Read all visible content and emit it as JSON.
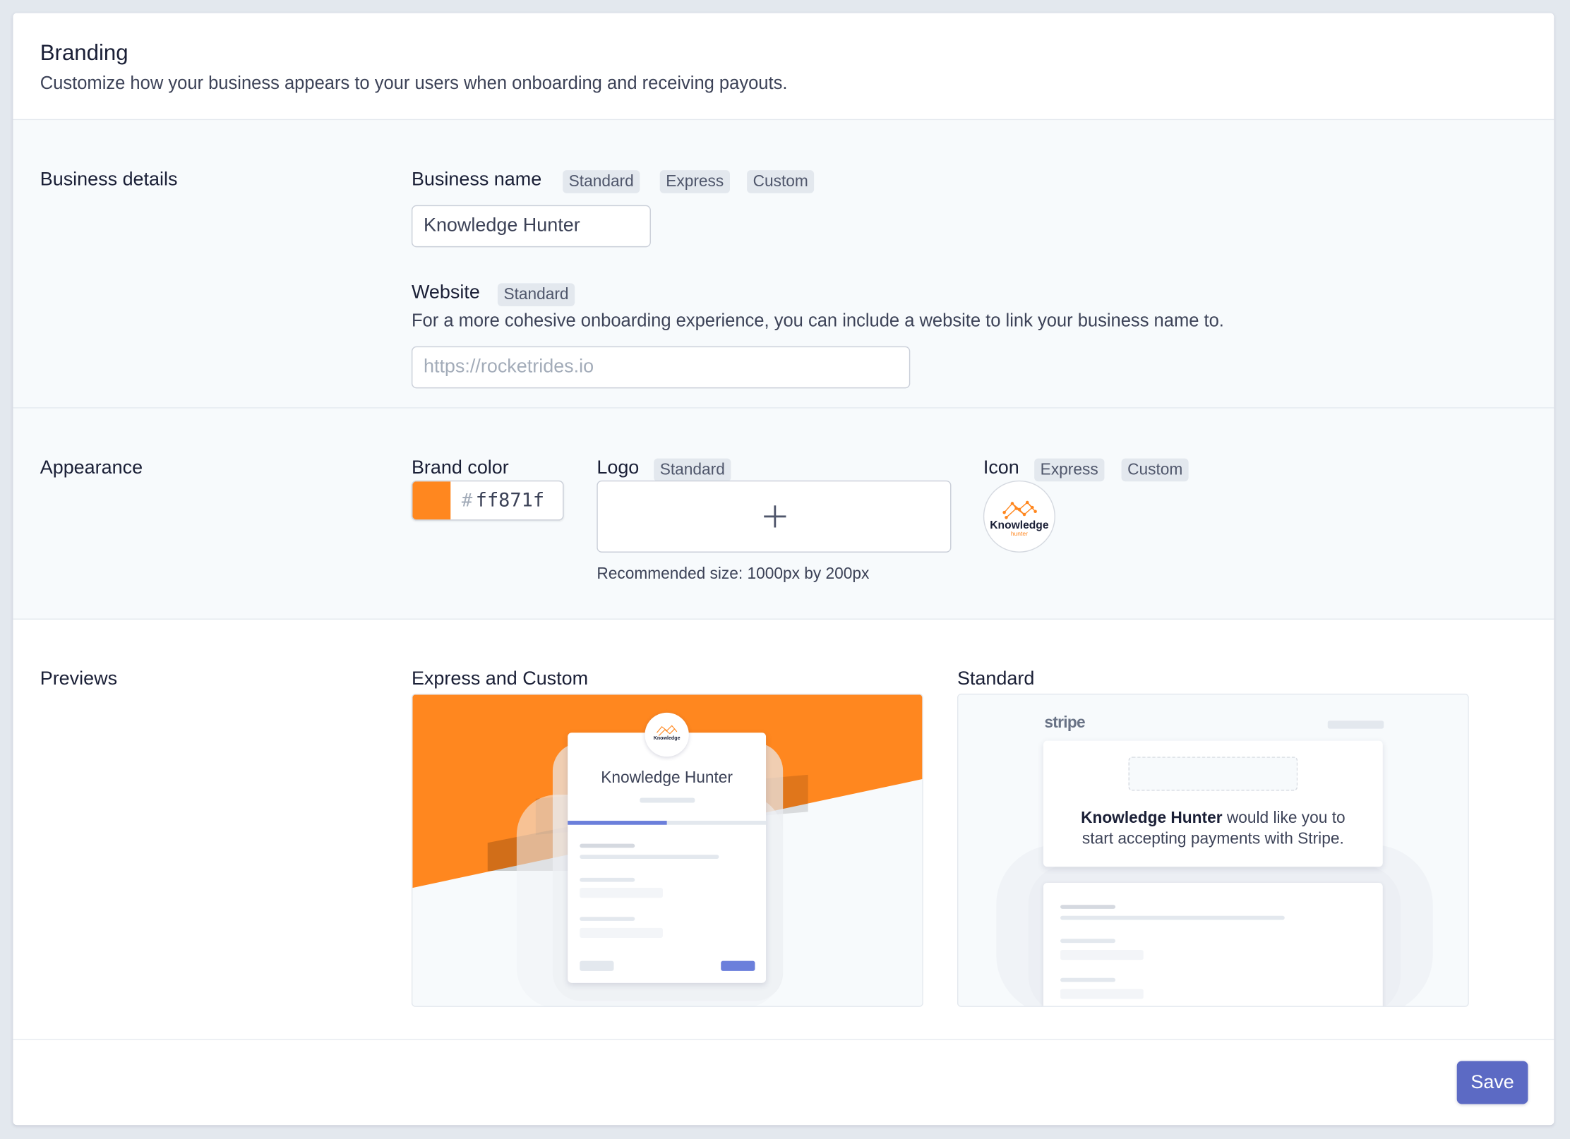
{
  "header": {
    "title": "Branding",
    "subtitle": "Customize how your business appears to your users when onboarding and receiving payouts."
  },
  "business_details": {
    "section_label": "Business details",
    "business_name": {
      "label": "Business name",
      "badges": [
        "Standard",
        "Express",
        "Custom"
      ],
      "value": "Knowledge Hunter"
    },
    "website": {
      "label": "Website",
      "badges": [
        "Standard"
      ],
      "help": "For a more cohesive onboarding experience, you can include a website to link your business name to.",
      "placeholder": "https://rocketrides.io",
      "value": ""
    }
  },
  "appearance": {
    "section_label": "Appearance",
    "brand_color": {
      "label": "Brand color",
      "hash": "#",
      "value": "ff871f",
      "color": "#ff871f"
    },
    "logo": {
      "label": "Logo",
      "badges": [
        "Standard"
      ],
      "help": "Recommended size: 1000px by 200px"
    },
    "icon": {
      "label": "Icon",
      "badges": [
        "Express",
        "Custom"
      ],
      "logo_text": "Knowledge",
      "logo_subtext": "hunter"
    }
  },
  "previews": {
    "section_label": "Previews",
    "express_custom": {
      "label": "Express and Custom",
      "business_name": "Knowledge Hunter",
      "icon_text": "Knowledge"
    },
    "standard": {
      "label": "Standard",
      "brand": "stripe",
      "business_name": "Knowledge Hunter",
      "message_rest": " would like you to",
      "message_line2": "start accepting payments with Stripe."
    }
  },
  "footer": {
    "save_label": "Save",
    "accent_color": "#5c6ac4"
  }
}
